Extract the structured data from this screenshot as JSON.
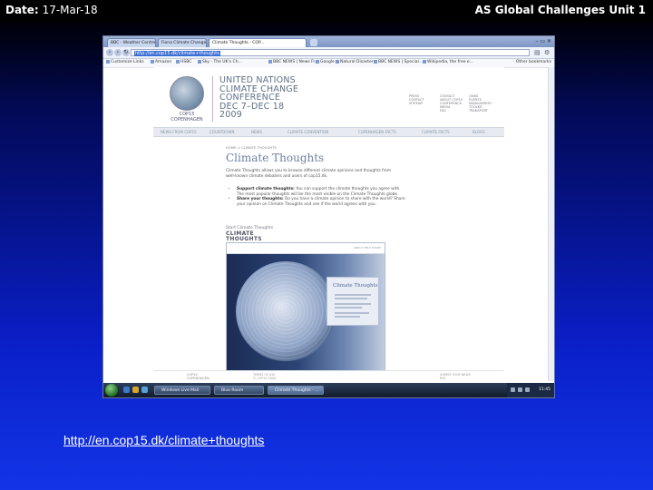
{
  "slide": {
    "date_label": "Date:",
    "date_value": "17-Mar-18",
    "unit_title": "AS Global Challenges Unit 1",
    "link_text": "http://en.cop15.dk/climate+thoughts"
  },
  "browser": {
    "tabs": [
      {
        "label": "BBC - Weather Centre - C..."
      },
      {
        "label": "Fiona Climate Change Te..."
      },
      {
        "label": "Climate Thoughts - COP..."
      }
    ],
    "window_controls": "– ▭ ✕",
    "address": "http://en.cop15.dk/climate+thoughts",
    "bookmarks": [
      "Customize Links",
      "Amazon",
      "HSBC",
      "Sky - The UK's Ch...",
      "BBC NEWS | News Fr...",
      "Google",
      "Natural Disaster",
      "BBC NEWS | Special...",
      "Wikipedia, the free e..."
    ],
    "other_bookmarks": "Other bookmarks"
  },
  "page": {
    "logo_caption": "COP15 COPENHAGEN",
    "conference_title": [
      "UNITED NATIONS",
      "CLIMATE CHANGE",
      "CONFERENCE",
      "DEC 7–DEC 18",
      "2009"
    ],
    "header_columns": [
      [
        "PRESS",
        "CONTACT",
        "SITEMAP"
      ],
      [
        "CONTACT",
        "ABOUT COP15",
        "CONFERENCE",
        "MEDIA",
        "FAQ"
      ],
      [
        "LINKS",
        "EVENTS",
        "MANAGEMENT",
        "TOOLKIT",
        "TRANSPORT"
      ]
    ],
    "nav": [
      "NEWS FROM COP15",
      "COUNTDOWN",
      "NEWS",
      "CLIMATE CONVENTION",
      "COPENHAGEN FACTS",
      "CLIMATE FACTS",
      "BLOGS"
    ],
    "breadcrumb": "HOME > CLIMATE THOUGHTS",
    "title": "Climate Thoughts",
    "intro": "Climate Thoughts allows you to browse different climate opinions and thoughts from well-known climate debaters and users of cop15.dk.",
    "bullets": [
      {
        "bold": "Support climate thoughts:",
        "text": " You can support the climate thoughts you agree with. The most popular thoughts will be the most visible on the Climate Thoughts globe."
      },
      {
        "bold": "Share your thoughts:",
        "text": " Do you have a climate opinion to share with the world? Share your opinion on Climate Thoughts and see if the world agrees with you."
      }
    ],
    "start_label": "Start Climate Thoughts",
    "app_logo": [
      "CLIMATE",
      "THOUGHTS"
    ],
    "app_top_links": "ABOUT   HELP   SHARE",
    "card_title": "Climate Thoughts",
    "footer_logo": [
      "COP15",
      "COPENHAGEN"
    ],
    "footer_mid": [
      "TERMS OF USE",
      "© COP15 2009"
    ],
    "footer_right": [
      "SUBMIT YOUR NEWS",
      "RSS"
    ]
  },
  "taskbar": {
    "tasks": [
      "Windows Live Mail",
      "Blue Room",
      "Climate Thoughts - ..."
    ],
    "clock": "11:45"
  },
  "colors": {
    "slide_bg_top": "#000000",
    "slide_bg_bottom": "#1235e6",
    "page_title": "#6d7fa2"
  }
}
